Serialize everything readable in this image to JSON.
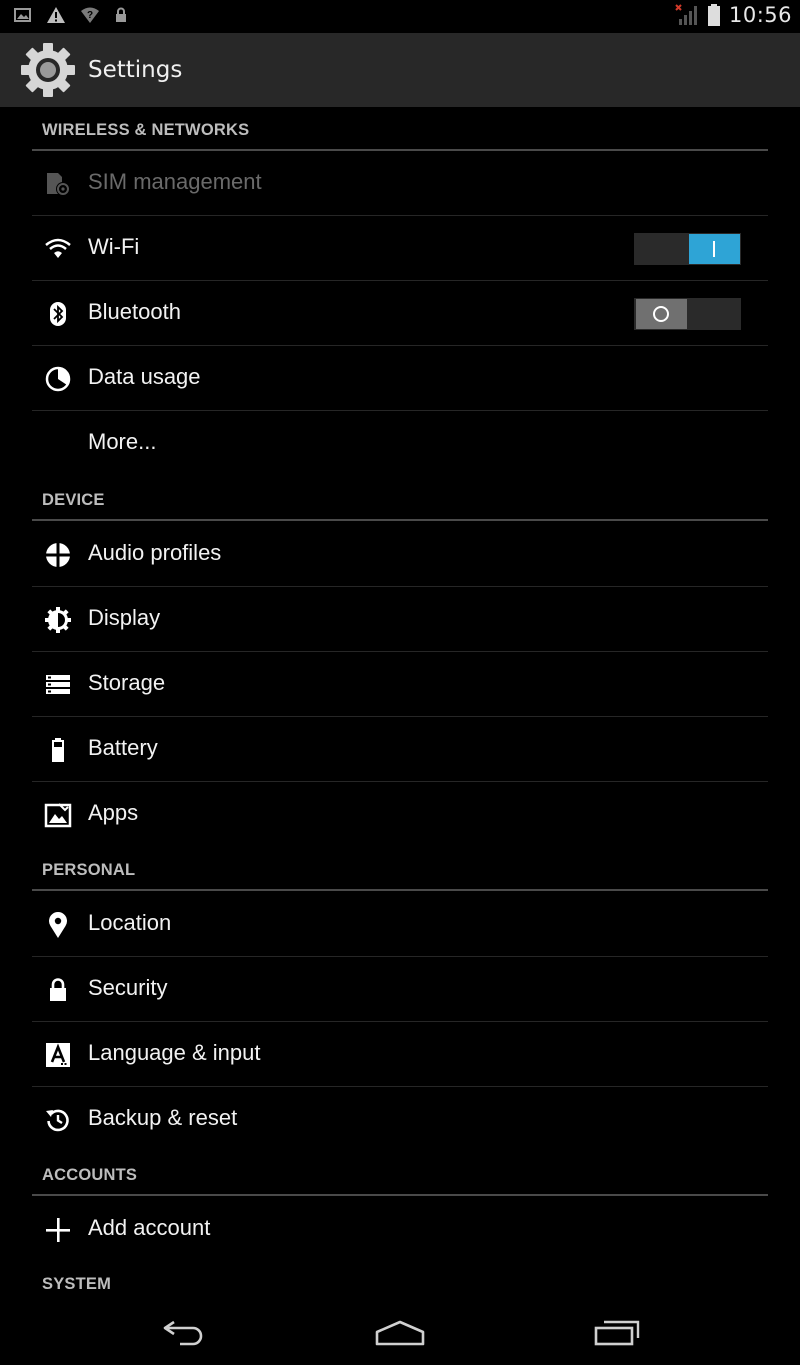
{
  "status_bar": {
    "time": "10:56",
    "left_icons": [
      "picture-icon",
      "warning-icon",
      "wifi-question-icon",
      "lock-icon"
    ],
    "right_icons": [
      "signal-no-sim-icon",
      "battery-icon"
    ]
  },
  "action_bar": {
    "title": "Settings",
    "icon": "settings-gear-icon"
  },
  "sections": {
    "wireless": {
      "header": "WIRELESS & NETWORKS",
      "sim": "SIM management",
      "wifi": "Wi-Fi",
      "bluetooth": "Bluetooth",
      "data_usage": "Data usage",
      "more": "More..."
    },
    "device": {
      "header": "DEVICE",
      "audio": "Audio profiles",
      "display": "Display",
      "storage": "Storage",
      "battery": "Battery",
      "apps": "Apps"
    },
    "personal": {
      "header": "PERSONAL",
      "location": "Location",
      "security": "Security",
      "language": "Language & input",
      "backup": "Backup & reset"
    },
    "accounts": {
      "header": "ACCOUNTS",
      "add_account": "Add account"
    },
    "system": {
      "header": "SYSTEM"
    }
  },
  "toggles": {
    "wifi": "on",
    "bluetooth": "off"
  },
  "colors": {
    "accent": "#2ea4d6",
    "background": "#000000",
    "action_bar": "#282828",
    "divider": "#4a4a4a"
  },
  "nav_bar": {
    "buttons": [
      "back-icon",
      "home-icon",
      "recent-apps-icon"
    ]
  }
}
